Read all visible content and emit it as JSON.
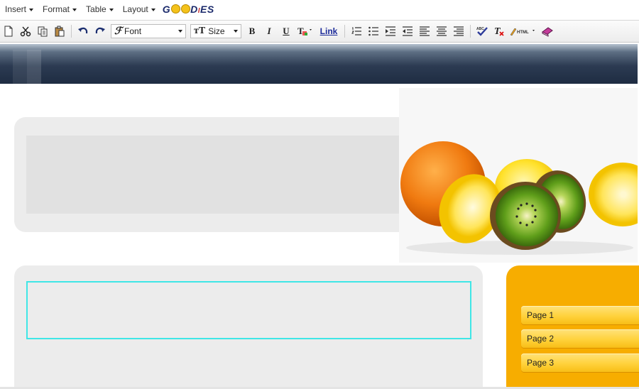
{
  "menubar": {
    "items": [
      {
        "label": "Insert"
      },
      {
        "label": "Format"
      },
      {
        "label": "Table"
      },
      {
        "label": "Layout"
      }
    ],
    "logo_text_parts": [
      "G",
      "D",
      "ES"
    ]
  },
  "toolbar": {
    "font_combo": "Font",
    "size_combo": "Size",
    "bold": "B",
    "italic": "I",
    "underline": "U",
    "link": "Link",
    "icons": [
      "new-document-icon",
      "cut-icon",
      "copy-icon",
      "paste-icon",
      "undo-icon",
      "redo-icon",
      "bold-icon",
      "italic-icon",
      "underline-icon",
      "text-color-icon",
      "link-icon",
      "ordered-list-icon",
      "unordered-list-icon",
      "indent-icon",
      "outdent-icon",
      "align-left-icon",
      "align-center-icon",
      "align-right-icon",
      "spellcheck-icon",
      "clear-format-icon",
      "html-source-icon",
      "help-book-icon"
    ],
    "html_label": "HTML",
    "spell_label": "ABC"
  },
  "nav": {
    "items": [
      {
        "label": "Page 1"
      },
      {
        "label": "Page 2"
      },
      {
        "label": "Page 3"
      }
    ]
  },
  "colors": {
    "header": "#1e2c42",
    "panel": "#ececec",
    "nav_bg": "#f7ad00",
    "nav_item": "#ffd23c",
    "selection": "#3fe6e6"
  }
}
